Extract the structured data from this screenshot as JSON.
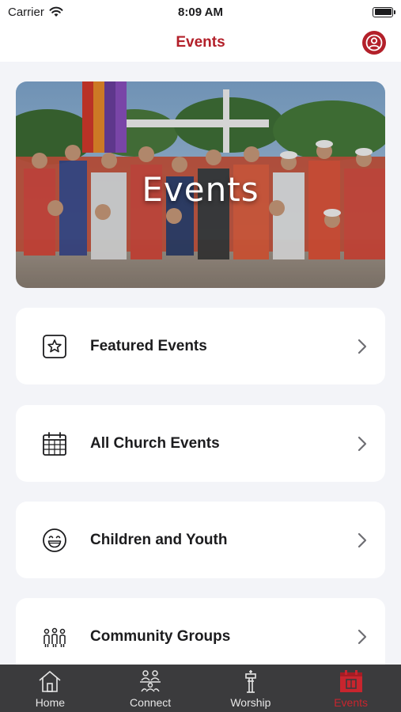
{
  "status_bar": {
    "carrier": "Carrier",
    "time": "8:09 AM"
  },
  "nav": {
    "title": "Events",
    "profile_icon": "person-circle-icon"
  },
  "hero": {
    "title": "Events"
  },
  "menu": [
    {
      "label": "Featured Events",
      "icon": "star-square-icon"
    },
    {
      "label": "All Church Events",
      "icon": "calendar-icon"
    },
    {
      "label": "Children and Youth",
      "icon": "smiley-icon"
    },
    {
      "label": "Community Groups",
      "icon": "people-group-icon"
    }
  ],
  "tabs": [
    {
      "label": "Home",
      "icon": "home-icon",
      "active": false
    },
    {
      "label": "Connect",
      "icon": "connect-icon",
      "active": false
    },
    {
      "label": "Worship",
      "icon": "worship-icon",
      "active": false
    },
    {
      "label": "Events",
      "icon": "events-calendar-icon",
      "active": true
    }
  ],
  "colors": {
    "accent": "#b3202a",
    "background": "#f3f4f8",
    "tab_bar": "#3b3b3d",
    "tab_active": "#c8252e"
  }
}
